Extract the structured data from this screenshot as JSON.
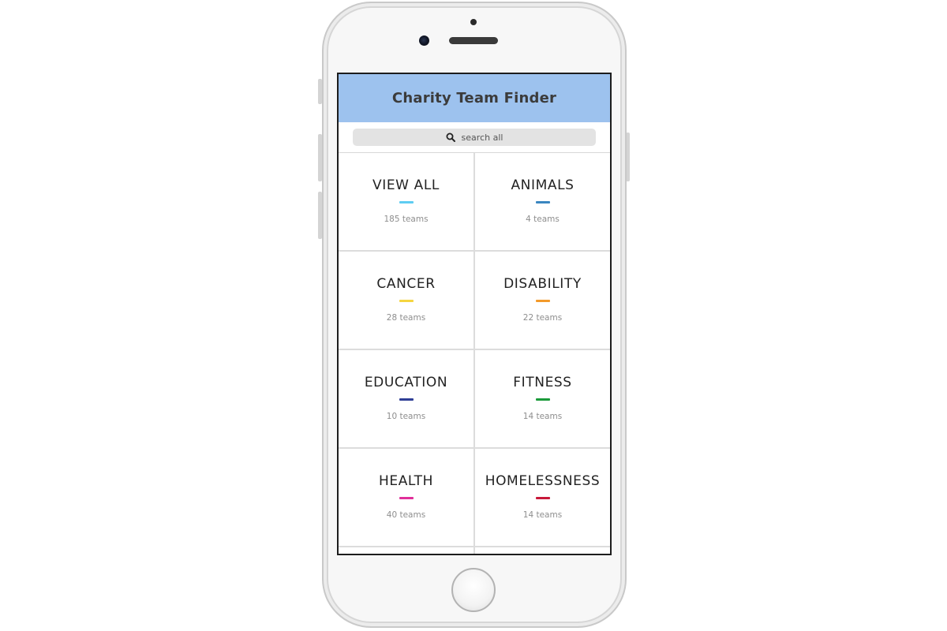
{
  "app": {
    "title": "Charity Team Finder"
  },
  "search": {
    "placeholder": "search all",
    "icon": "search-icon"
  },
  "categories": [
    {
      "name": "VIEW ALL",
      "count": "185 teams",
      "color": "#5ecdf2"
    },
    {
      "name": "ANIMALS",
      "count": "4 teams",
      "color": "#3a86c0"
    },
    {
      "name": "CANCER",
      "count": "28 teams",
      "color": "#f5d540"
    },
    {
      "name": "DISABILITY",
      "count": "22 teams",
      "color": "#f39a2a"
    },
    {
      "name": "EDUCATION",
      "count": "10 teams",
      "color": "#2f3f96"
    },
    {
      "name": "FITNESS",
      "count": "14 teams",
      "color": "#1b9a3a"
    },
    {
      "name": "HEALTH",
      "count": "40 teams",
      "color": "#e0309a"
    },
    {
      "name": "HOMELESSNESS",
      "count": "14 teams",
      "color": "#c8193a"
    }
  ],
  "colors": {
    "header_bg": "#9dc2ee",
    "search_bg": "#e3e3e3"
  }
}
